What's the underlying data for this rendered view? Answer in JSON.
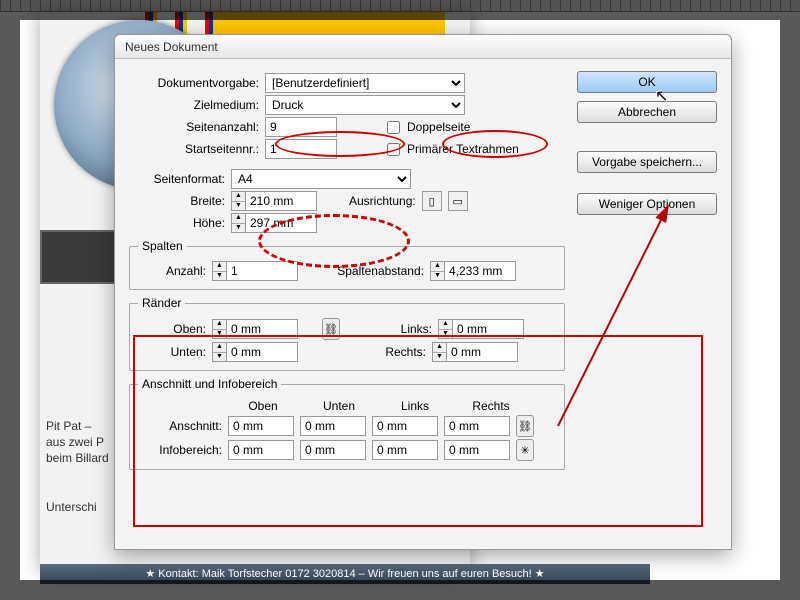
{
  "dialog_title": "Neues Dokument",
  "presets": {
    "label": "Dokumentvorgabe:",
    "value": "[Benutzerdefiniert]"
  },
  "intent": {
    "label": "Zielmedium:",
    "value": "Druck"
  },
  "pages": {
    "label": "Seitenanzahl:",
    "value": "9"
  },
  "start": {
    "label": "Startseitennr.:",
    "value": "1"
  },
  "facing": {
    "label": "Doppelseite",
    "checked": false
  },
  "primary": {
    "label": "Primärer Textrahmen",
    "checked": false
  },
  "pagesize": {
    "label": "Seitenformat:",
    "value": "A4"
  },
  "width": {
    "label": "Breite:",
    "value": "210 mm"
  },
  "height": {
    "label": "Höhe:",
    "value": "297 mm"
  },
  "orient_label": "Ausrichtung:",
  "columns": {
    "legend": "Spalten",
    "count": {
      "label": "Anzahl:",
      "value": "1"
    },
    "gutter": {
      "label": "Spaltenabstand:",
      "value": "4,233 mm"
    }
  },
  "margins": {
    "legend": "Ränder",
    "top": {
      "label": "Oben:",
      "value": "0 mm"
    },
    "bottom": {
      "label": "Unten:",
      "value": "0 mm"
    },
    "left": {
      "label": "Links:",
      "value": "0 mm"
    },
    "right": {
      "label": "Rechts:",
      "value": "0 mm"
    }
  },
  "bleed": {
    "legend": "Anschnitt und Infobereich",
    "hdr_top": "Oben",
    "hdr_bot": "Unten",
    "hdr_l": "Links",
    "hdr_r": "Rechts",
    "bleed_row": {
      "label": "Anschnitt:",
      "top": "0 mm",
      "bot": "0 mm",
      "l": "0 mm",
      "r": "0 mm"
    },
    "slug_row": {
      "label": "Infobereich:",
      "top": "0 mm",
      "bot": "0 mm",
      "l": "0 mm",
      "r": "0 mm"
    }
  },
  "buttons": {
    "ok": "OK",
    "cancel": "Abbrechen",
    "save": "Vorgabe speichern...",
    "less": "Weniger Optionen"
  },
  "bg": {
    "side1": "Pit Pat –",
    "side2": "aus zwei P",
    "side3": "beim Billard",
    "side4": "Unterschi",
    "footer": "★ Kontakt: Maik Torfstecher 0172 3020814 – Wir freuen uns auf euren Besuch! ★"
  }
}
